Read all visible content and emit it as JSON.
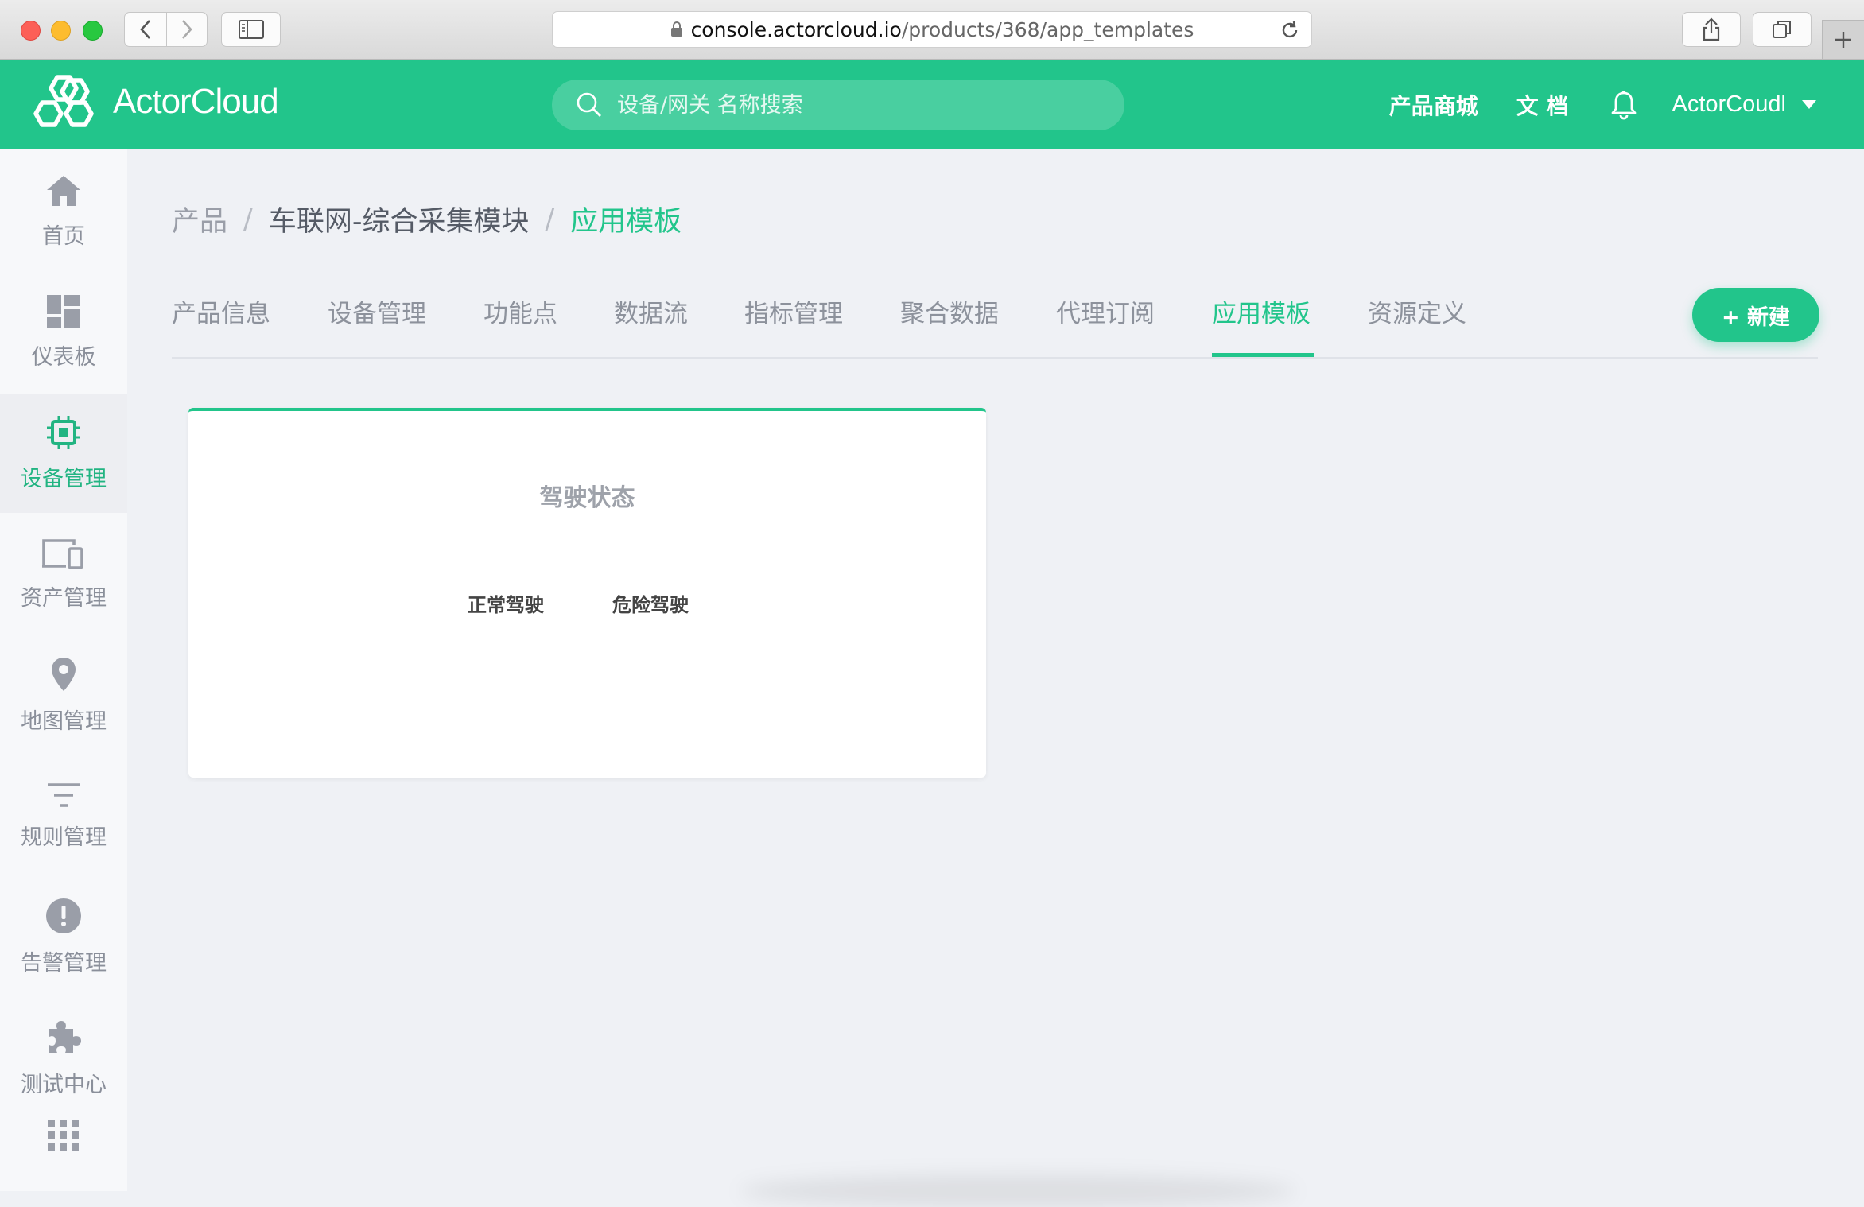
{
  "browser": {
    "url_host": "console.actorcloud.io",
    "url_path": "/products/368/app_templates"
  },
  "header": {
    "logo_text": "ActorCloud",
    "search_placeholder": "设备/网关 名称搜索",
    "links": [
      "产品商城",
      "文 档"
    ],
    "user_name": "ActorCoudl"
  },
  "sidebar": {
    "items": [
      {
        "label": "首页",
        "icon": "home-icon",
        "active": false
      },
      {
        "label": "仪表板",
        "icon": "dashboard-icon",
        "active": false
      },
      {
        "label": "设备管理",
        "icon": "chip-icon",
        "active": true
      },
      {
        "label": "资产管理",
        "icon": "devices-icon",
        "active": false
      },
      {
        "label": "地图管理",
        "icon": "map-pin-icon",
        "active": false
      },
      {
        "label": "规则管理",
        "icon": "filter-icon",
        "active": false
      },
      {
        "label": "告警管理",
        "icon": "alert-icon",
        "active": false
      },
      {
        "label": "测试中心",
        "icon": "puzzle-icon",
        "active": false
      }
    ]
  },
  "breadcrumb": {
    "root": "产品",
    "sep": "/",
    "product": "车联网-综合采集模块",
    "current": "应用模板"
  },
  "tabs": [
    "产品信息",
    "设备管理",
    "功能点",
    "数据流",
    "指标管理",
    "聚合数据",
    "代理订阅",
    "应用模板",
    "资源定义"
  ],
  "active_tab": "应用模板",
  "new_button": "+ 新建",
  "template_card": {
    "title": "驾驶状态",
    "options": [
      "正常驾驶",
      "危险驾驶"
    ]
  },
  "colors": {
    "brand": "#22c58b",
    "sidebar_bg": "#f7f8fa",
    "main_bg": "#eff1f5"
  }
}
